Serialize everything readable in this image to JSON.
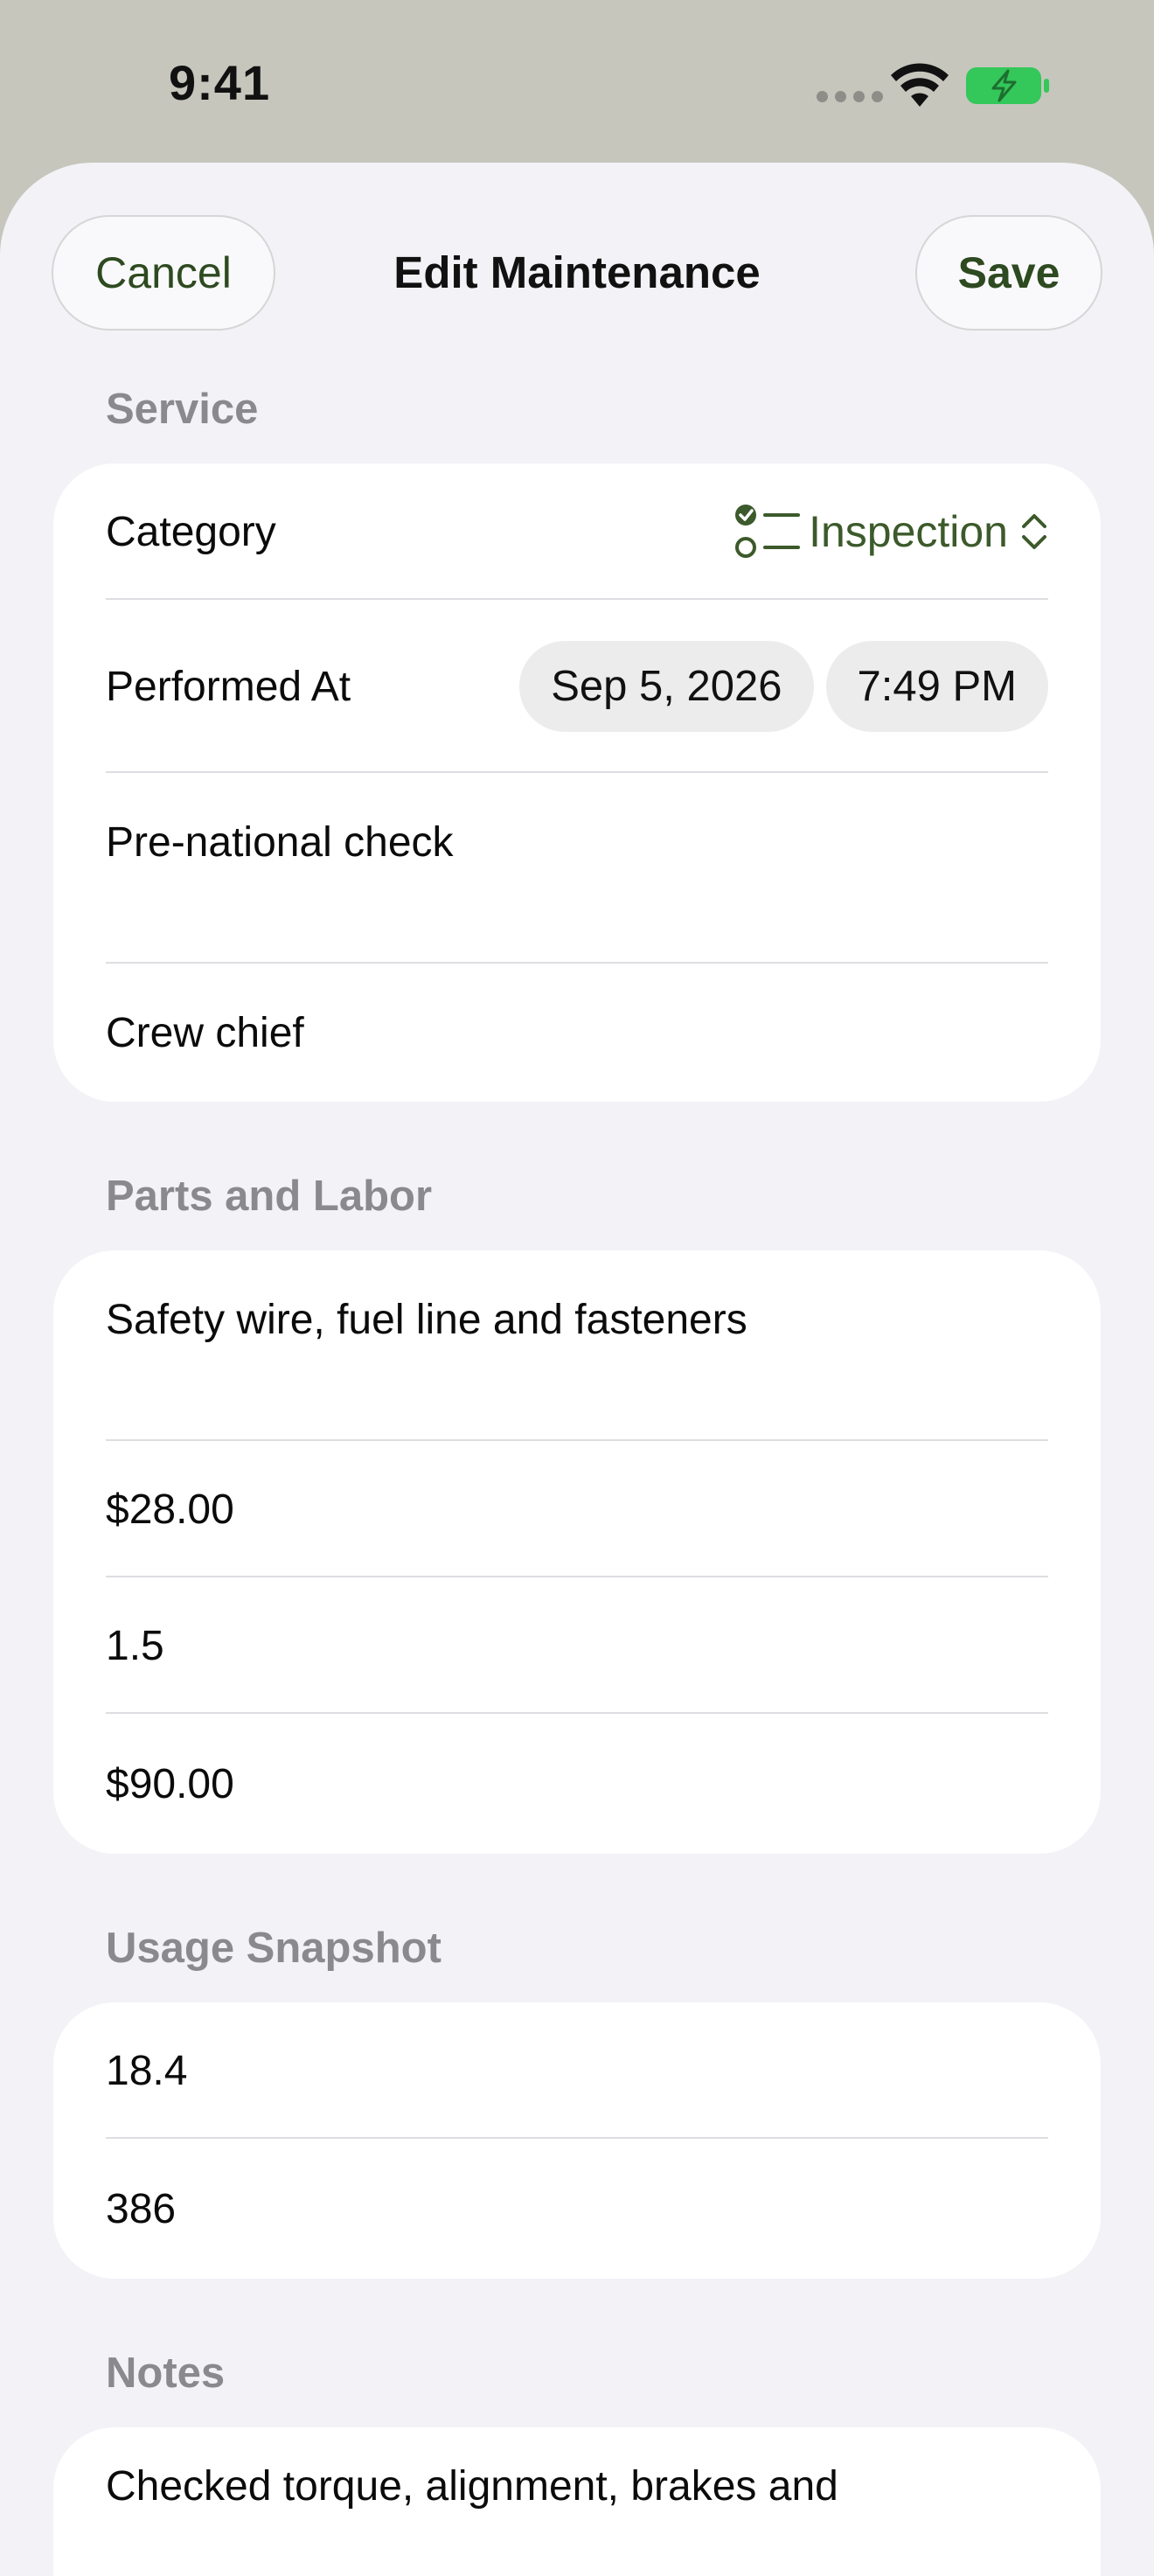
{
  "status_bar": {
    "time": "9:41"
  },
  "nav": {
    "cancel_label": "Cancel",
    "title": "Edit Maintenance",
    "save_label": "Save"
  },
  "service": {
    "header": "Service",
    "category_label": "Category",
    "category_value": "Inspection",
    "category_icon": "checklist-icon",
    "performed_label": "Performed At",
    "performed_date": "Sep 5, 2026",
    "performed_time": "7:49 PM",
    "description": "Pre-national check",
    "performed_by": "Crew chief"
  },
  "parts_labor": {
    "header": "Parts and Labor",
    "parts": "Safety wire, fuel line and fasteners",
    "parts_cost": "$28.00",
    "labor_hours": "1.5",
    "labor_cost": "$90.00"
  },
  "usage": {
    "header": "Usage Snapshot",
    "hours": "18.4",
    "distance": "386"
  },
  "notes": {
    "header": "Notes",
    "text": "Checked torque, alignment, brakes and"
  },
  "colors": {
    "accent": "#3c5a2b",
    "background": "#f2f2f7",
    "card": "#ffffff",
    "battery": "#34c759"
  }
}
